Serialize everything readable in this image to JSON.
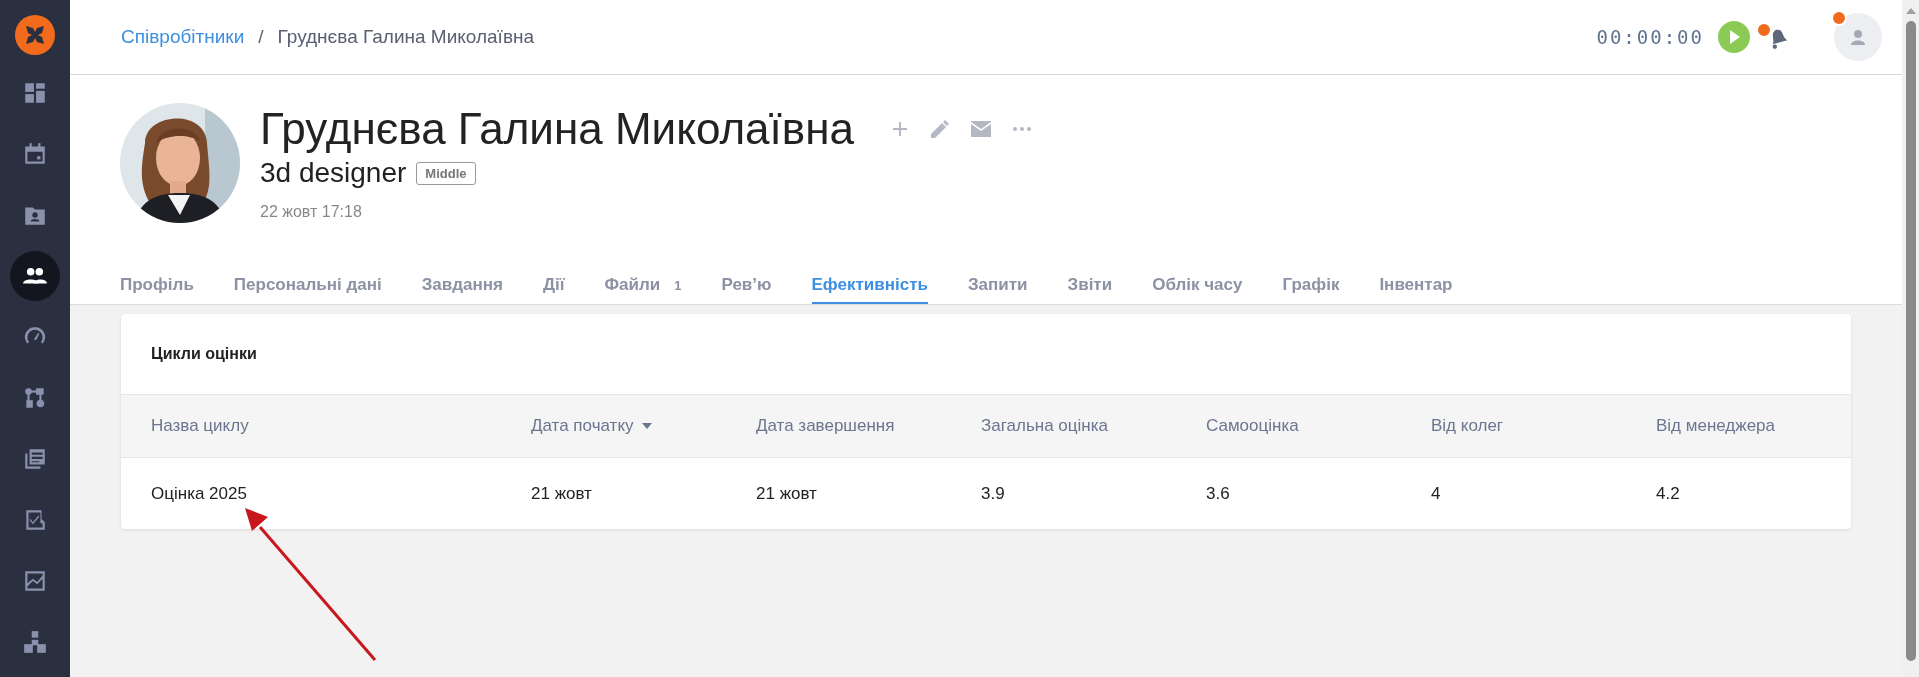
{
  "sidebar": {
    "items": [
      {
        "selected": false
      },
      {
        "selected": false
      },
      {
        "selected": false
      },
      {
        "selected": true
      },
      {
        "selected": false
      },
      {
        "selected": false
      },
      {
        "selected": false
      },
      {
        "selected": false
      },
      {
        "selected": false
      },
      {
        "selected": false
      }
    ]
  },
  "breadcrumb": {
    "parent": "Співробітники",
    "separator": "/",
    "current": "Груднєва Галина Миколаївна"
  },
  "header": {
    "timer": "00:00:00",
    "bell_badge": true,
    "user_badge": true
  },
  "profile": {
    "name": "Груднєва Галина Миколаївна",
    "position": "3d designer",
    "level": "Middle",
    "date": "22 жовт 17:18"
  },
  "tabs": [
    {
      "label": "Профіль",
      "selected": false
    },
    {
      "label": "Персональні дані",
      "selected": false
    },
    {
      "label": "Завдання",
      "selected": false
    },
    {
      "label": "Дії",
      "selected": false
    },
    {
      "label": "Файли",
      "count": "1",
      "selected": false
    },
    {
      "label": "Рев’ю",
      "selected": false
    },
    {
      "label": "Ефективність",
      "selected": true
    },
    {
      "label": "Запити",
      "selected": false
    },
    {
      "label": "Звіти",
      "selected": false
    },
    {
      "label": "Облік часу",
      "selected": false
    },
    {
      "label": "Графік",
      "selected": false
    },
    {
      "label": "Інвентар",
      "selected": false
    }
  ],
  "table": {
    "title": "Цикли оцінки",
    "columns": [
      {
        "label": "Назва циклу",
        "sorted": false
      },
      {
        "label": "Дата початку",
        "sorted": true
      },
      {
        "label": "Дата завершення",
        "sorted": false
      },
      {
        "label": "Загальна оцінка",
        "sorted": false
      },
      {
        "label": "Самооцінка",
        "sorted": false
      },
      {
        "label": "Від колег",
        "sorted": false
      },
      {
        "label": "Від менеджера",
        "sorted": false
      }
    ],
    "rows": [
      [
        "Оцінка 2025",
        "21 жовт",
        "21 жовт",
        "3.9",
        "3.6",
        "4",
        "4.2"
      ]
    ]
  }
}
